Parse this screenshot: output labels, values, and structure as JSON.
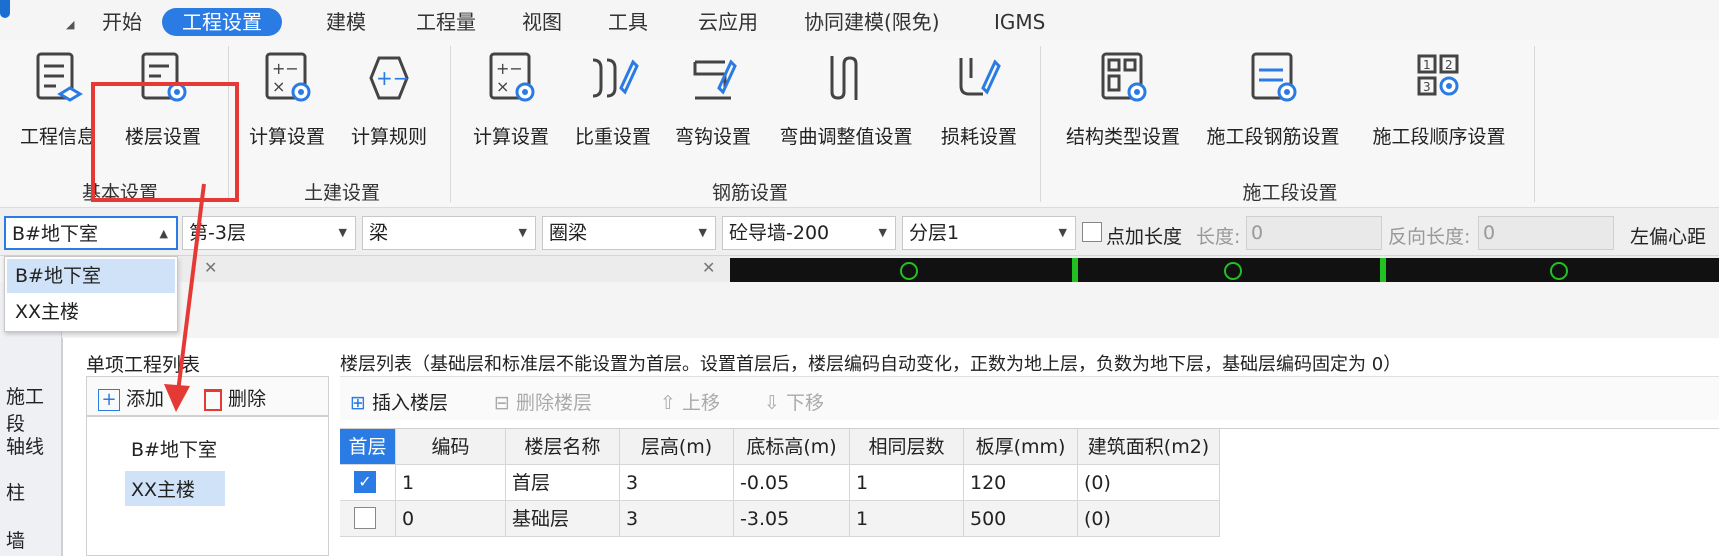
{
  "menu": {
    "tabs": [
      {
        "label": "开始"
      },
      {
        "label": "工程设置"
      },
      {
        "label": "建模"
      },
      {
        "label": "工程量"
      },
      {
        "label": "视图"
      },
      {
        "label": "工具"
      },
      {
        "label": "云应用"
      },
      {
        "label": "协同建模(限免)"
      },
      {
        "label": "IGMS"
      }
    ],
    "active_index": 1
  },
  "ribbon": {
    "groups": [
      {
        "label": "基本设置",
        "buttons": [
          {
            "label": "工程信息",
            "icon": "project-info-icon"
          },
          {
            "label": "楼层设置",
            "icon": "floor-settings-icon"
          }
        ]
      },
      {
        "label": "土建设置",
        "buttons": [
          {
            "label": "计算设置",
            "icon": "calc-settings-icon"
          },
          {
            "label": "计算规则",
            "icon": "calc-rules-icon"
          }
        ]
      },
      {
        "label": "钢筋设置",
        "buttons": [
          {
            "label": "计算设置",
            "icon": "rebar-calc-settings-icon"
          },
          {
            "label": "比重设置",
            "icon": "density-settings-icon"
          },
          {
            "label": "弯钩设置",
            "icon": "hook-settings-icon"
          },
          {
            "label": "弯曲调整值设置",
            "icon": "bend-adjust-icon"
          },
          {
            "label": "损耗设置",
            "icon": "loss-settings-icon"
          }
        ]
      },
      {
        "label": "施工段设置",
        "buttons": [
          {
            "label": "结构类型设置",
            "icon": "structure-type-icon"
          },
          {
            "label": "施工段钢筋设置",
            "icon": "segment-rebar-icon"
          },
          {
            "label": "施工段顺序设置",
            "icon": "segment-order-icon"
          }
        ]
      }
    ],
    "highlight_color": "#e53935"
  },
  "selectors": {
    "unit": "B#地下室",
    "floor": "第-3层",
    "type": "梁",
    "subtype": "圈梁",
    "component": "砼导墙-200",
    "layer": "分层1",
    "add_length_label": "点加长度",
    "length_label": "长度:",
    "length_value": "0",
    "reverse_length_label": "反向长度:",
    "reverse_length_value": "0",
    "left_offset_label": "左偏心距"
  },
  "dropdown": {
    "options": [
      "B#地下室",
      "XX主楼"
    ],
    "selected_index": 0
  },
  "sidebar": {
    "items": [
      "施工段",
      "轴线",
      "柱",
      "墙"
    ]
  },
  "dialog": {
    "unit_list_title": "单项工程列表",
    "add_label": "添加",
    "delete_label": "删除",
    "units": [
      "B#地下室",
      "XX主楼"
    ],
    "selected_unit_index": 1,
    "floor_list_title": "楼层列表（基础层和标准层不能设置为首层。设置首层后，楼层编码自动变化，正数为地上层，负数为地下层，基础层编码固定为 0）",
    "insert_floor": "插入楼层",
    "delete_floor": "删除楼层",
    "move_up": "上移",
    "move_down": "下移",
    "columns": [
      "首层",
      "编码",
      "楼层名称",
      "层高(m)",
      "底标高(m)",
      "相同层数",
      "板厚(mm)",
      "建筑面积(m2)"
    ],
    "rows": [
      {
        "first": true,
        "code": "1",
        "name": "首层",
        "height": "3",
        "bottom": "-0.05",
        "same": "1",
        "slab": "120",
        "area": "(0)"
      },
      {
        "first": false,
        "code": "0",
        "name": "基础层",
        "height": "3",
        "bottom": "-3.05",
        "same": "1",
        "slab": "500",
        "area": "(0)"
      }
    ]
  },
  "colors": {
    "accent": "#2b7be4",
    "annotation": "#e53935"
  }
}
